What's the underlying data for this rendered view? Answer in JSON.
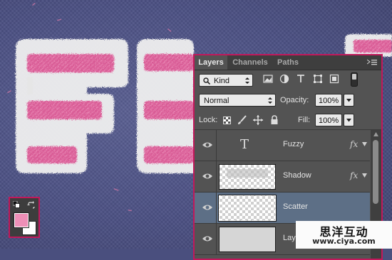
{
  "canvas": {
    "artwork_letters": [
      "F",
      "U",
      "Z"
    ],
    "background_color": "#4b5083",
    "fur_color": "#f2f2f2",
    "stripe_color": "#d95c96"
  },
  "tools": {
    "foreground_color": "#ee8fb7",
    "background_color": "#ffffff",
    "default_colors_icon": "default-colors-icon",
    "swap_icon": "swap-colors-icon"
  },
  "layers_panel": {
    "tabs": [
      {
        "label": "Layers",
        "active": true
      },
      {
        "label": "Channels",
        "active": false
      },
      {
        "label": "Paths",
        "active": false
      }
    ],
    "filter": {
      "kind_label": "Kind",
      "icons": [
        "pixel-filter-icon",
        "adjustment-filter-icon",
        "type-filter-icon",
        "shape-filter-icon",
        "smart-object-filter-icon",
        "filter-toggle"
      ]
    },
    "blend_mode": "Normal",
    "opacity_label": "Opacity:",
    "opacity_value": "100%",
    "lock_label": "Lock:",
    "fill_label": "Fill:",
    "fill_value": "100%",
    "layers": [
      {
        "name": "Fuzzy",
        "type": "text",
        "has_fx": true,
        "selected": false,
        "fx_label": "fx"
      },
      {
        "name": "Shadow",
        "type": "pixel",
        "has_fx": true,
        "selected": false,
        "fx_label": "fx"
      },
      {
        "name": "Scatter",
        "type": "pixel",
        "has_fx": false,
        "selected": true
      },
      {
        "name": "Layer 1",
        "type": "pixel",
        "has_fx": false,
        "selected": false
      }
    ],
    "type_thumb_glyph": "T",
    "accent_color": "#c2185b",
    "selected_row_color": "#5d6f86"
  },
  "watermark": {
    "chinese": "思洋互动",
    "url": "www.ciya.com"
  }
}
